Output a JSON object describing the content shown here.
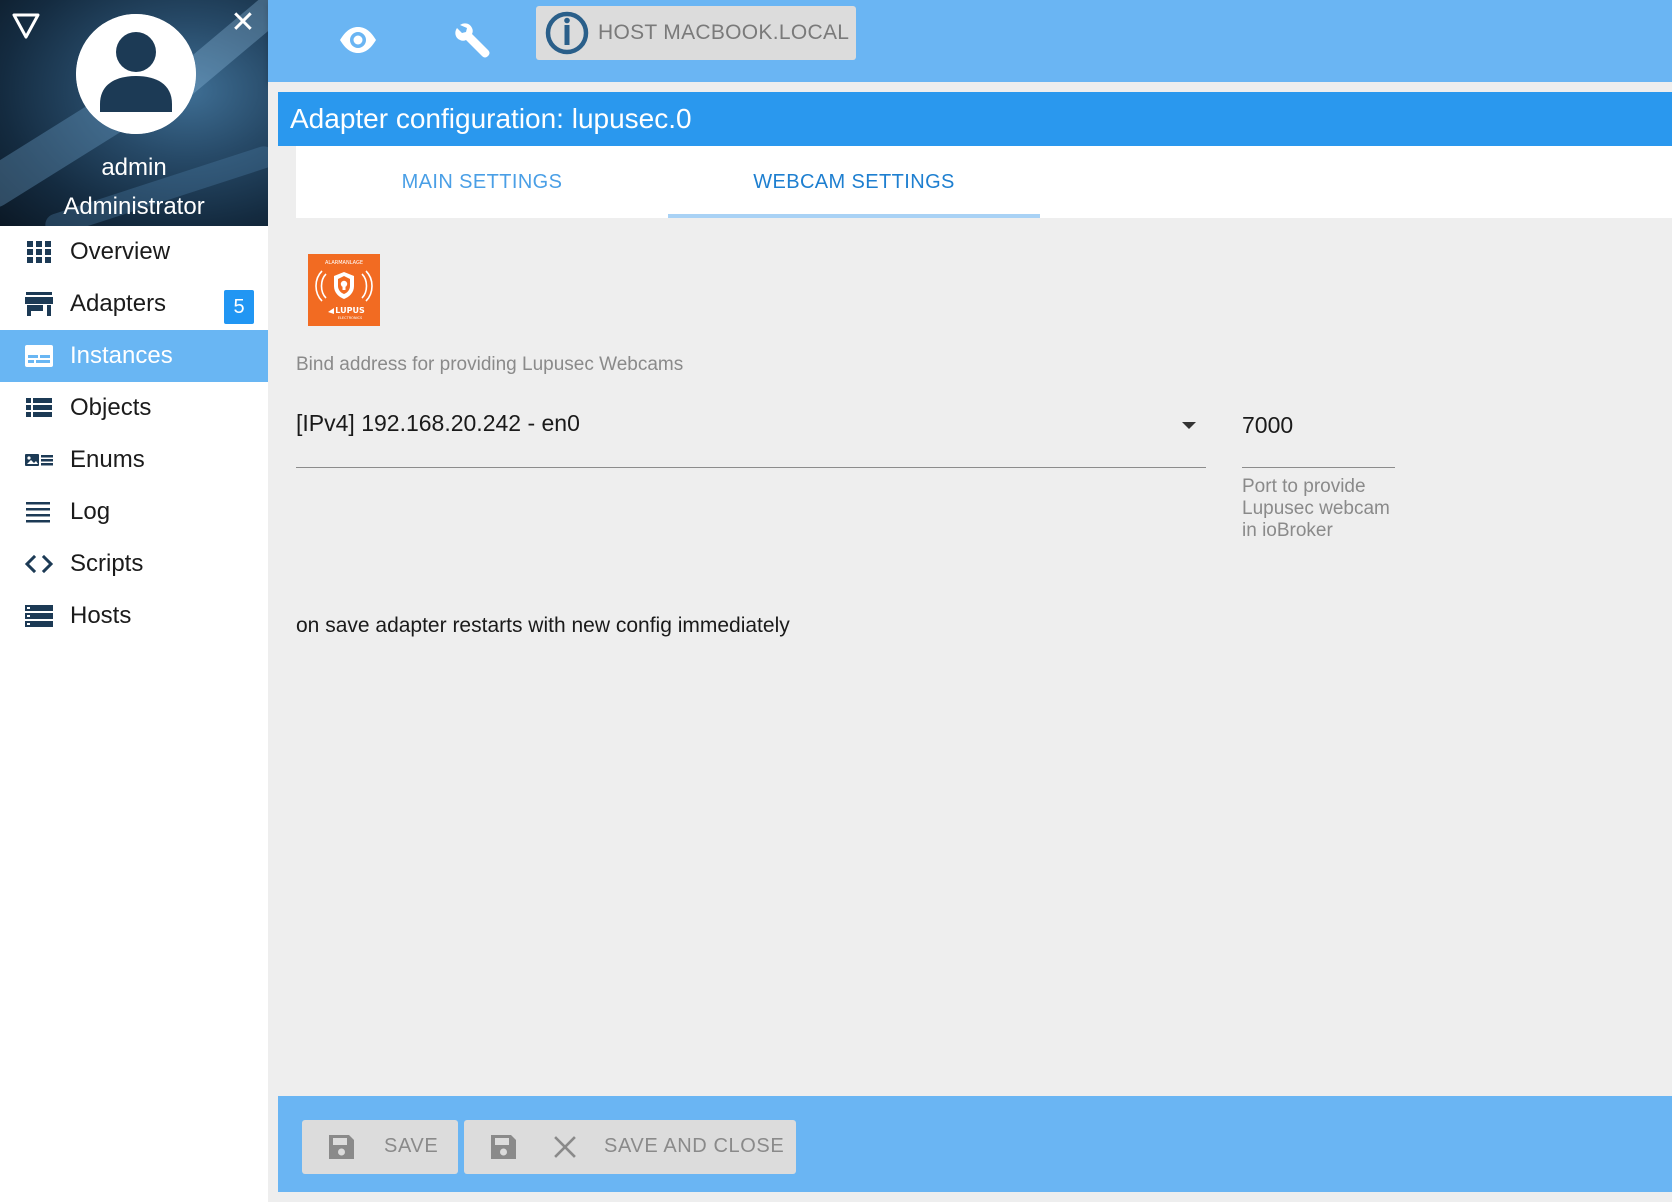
{
  "sidebar": {
    "user": {
      "name": "admin",
      "role": "Administrator"
    },
    "items": [
      {
        "label": "Overview",
        "icon": "grid-icon"
      },
      {
        "label": "Adapters",
        "icon": "store-icon",
        "badge": "5"
      },
      {
        "label": "Instances",
        "icon": "instances-icon",
        "active": true
      },
      {
        "label": "Objects",
        "icon": "list-icon"
      },
      {
        "label": "Enums",
        "icon": "enum-icon"
      },
      {
        "label": "Log",
        "icon": "lines-icon"
      },
      {
        "label": "Scripts",
        "icon": "code-icon"
      },
      {
        "label": "Hosts",
        "icon": "server-icon"
      }
    ]
  },
  "topbar": {
    "host_label": "HOST MACBOOK.LOCAL",
    "icons": [
      "eye-icon",
      "wrench-icon",
      "iobroker-logo-icon"
    ]
  },
  "main": {
    "title": "Adapter configuration: lupusec.0",
    "tabs": [
      {
        "label": "MAIN SETTINGS",
        "active": false
      },
      {
        "label": "WEBCAM SETTINGS",
        "active": true
      }
    ],
    "bind_label": "Bind address for providing Lupusec Webcams",
    "bind_value": "[IPv4] 192.168.20.242 - en0",
    "port_value": "7000",
    "port_help": "Port to provide Lupusec webcam in ioBroker",
    "save_note": "on save adapter restarts with new config immediately",
    "adapter_logo": {
      "top_text": "ALARMANLAGE",
      "brand": "LUPUS",
      "sub_text": "ELECTRONICS"
    }
  },
  "footer": {
    "save_label": "SAVE",
    "save_close_label": "SAVE AND CLOSE"
  },
  "colors": {
    "accent": "#2a98ee",
    "topbar": "#6ab5f3",
    "active_menu": "#69b6f3",
    "badge": "#2196f3",
    "lupus_orange": "#f26b22"
  }
}
